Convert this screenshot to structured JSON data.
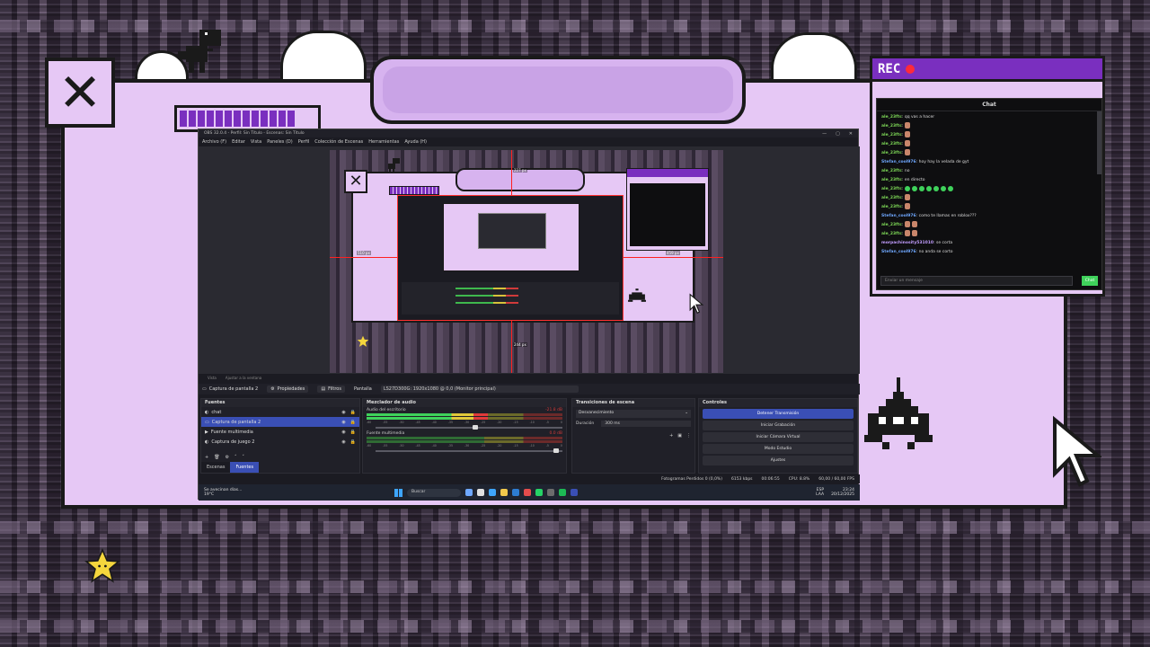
{
  "frame": {
    "close_glyph": "✕",
    "progress": 0.85
  },
  "rec": {
    "label": "REC",
    "chat_title": "Chat",
    "input_placeholder": "Enviar un mensaje",
    "send_label": "Chat",
    "messages": [
      {
        "user": "ale_23ftc",
        "text": ": qq vas a hacer",
        "emotes": 0,
        "color": "green"
      },
      {
        "user": "ale_23ftc",
        "text": ":",
        "emotes": 1,
        "color": "green"
      },
      {
        "user": "ale_23ftc",
        "text": ":",
        "emotes": 1,
        "color": "green"
      },
      {
        "user": "ale_23ftc",
        "text": ":",
        "emotes": 1,
        "color": "green"
      },
      {
        "user": "ale_23ftc",
        "text": ":",
        "emotes": 1,
        "color": "green"
      },
      {
        "user": "Stefan_cool976",
        "text": ": hoy hay la velada de gyt",
        "emotes": 0,
        "color": "blue"
      },
      {
        "user": "ale_23ftc",
        "text": ": no",
        "emotes": 0,
        "color": "green"
      },
      {
        "user": "ale_23ftc",
        "text": ": en directo",
        "emotes": 0,
        "color": "green"
      },
      {
        "user": "ale_23ftc",
        "text": ":",
        "emotes": 7,
        "color": "green"
      },
      {
        "user": "ale_23ftc",
        "text": ":",
        "emotes": 1,
        "color": "green"
      },
      {
        "user": "ale_23ftc",
        "text": ":",
        "emotes": 1,
        "color": "green"
      },
      {
        "user": "Stefan_cool976",
        "text": ": como te llamas en roblox???",
        "emotes": 0,
        "color": "blue"
      },
      {
        "user": "ale_23ftc",
        "text": ":",
        "emotes": 2,
        "color": "green"
      },
      {
        "user": "ale_23ftc",
        "text": ":",
        "emotes": 2,
        "color": "green"
      },
      {
        "user": "morpachinosity531010",
        "text": ": se corta",
        "emotes": 0,
        "color": "purple"
      },
      {
        "user": "Stefan_cool976",
        "text": ": no anda se corto",
        "emotes": 0,
        "color": "blue"
      }
    ]
  },
  "obs": {
    "title": "OBS 32.0.4 - Perfil: Sin Título - Escenas: Sin Título",
    "window_buttons": [
      "—",
      "▢",
      "✕"
    ],
    "menus": [
      "Archivo (F)",
      "Editar",
      "Vista",
      "Paneles (D)",
      "Perfil",
      "Colección de Escenas",
      "Herramientas",
      "Ayuda (H)"
    ],
    "guides": {
      "top": "227 px",
      "left": "510 px",
      "right": "459 px",
      "bottom": "244 px"
    },
    "tools": [
      "Vista",
      "Ajustar a la ventana"
    ],
    "sourcebar": {
      "source": "Captura de pantalla 2",
      "props": "Propiedades",
      "filters": "Filtros",
      "screen_label": "Pantalla",
      "screen_value": "LS27D300G: 1920x1080 @ 0,0 (Monitor principal)"
    },
    "sources": {
      "title": "Fuentes",
      "items": [
        {
          "icon": "chat-source-icon",
          "name": "chat",
          "selected": false
        },
        {
          "icon": "display-capture-icon",
          "name": "Captura de pantalla 2",
          "selected": true
        },
        {
          "icon": "media-source-icon",
          "name": "Fuente multimedia",
          "selected": false
        },
        {
          "icon": "game-capture-icon",
          "name": "Captura de juego 2",
          "selected": false
        }
      ],
      "tabs": [
        "Escenas",
        "Fuentes"
      ]
    },
    "mixer": {
      "title": "Mezclador de audio",
      "tracks": [
        {
          "name": "Audio del escritorio",
          "db": "-21.8 dB",
          "level": 0.62,
          "volume": 0.55
        },
        {
          "name": "Fuente multimedia",
          "db": "0.0 dB",
          "level": 0.0,
          "volume": 0.98
        }
      ],
      "scale": [
        "-60",
        "-55",
        "-50",
        "-45",
        "-40",
        "-35",
        "-30",
        "-25",
        "-20",
        "-15",
        "-10",
        "-5",
        "0"
      ]
    },
    "transitions": {
      "title": "Transiciones de escena",
      "selected": "Desvanecimiento",
      "duration_label": "Duración",
      "duration_value": "300 ms"
    },
    "controls": {
      "title": "Controles",
      "buttons": [
        "Detener Transmisión",
        "Iniciar Grabación",
        "Iniciar Cámara Virtual",
        "Modo Estudio",
        "Ajustes"
      ]
    },
    "status": {
      "dropped": "Fotogramas Perdidos 0 (0,0%)",
      "bitrate": "6153 kbps",
      "time": "00:06:55",
      "cpu": "CPU: 8.8%",
      "fps": "60,00 / 60,00 FPS"
    }
  },
  "taskbar": {
    "weather_line1": "Se avecinan días...",
    "weather_line2": "19°C",
    "search": "Buscar",
    "lang1": "ESP",
    "lang2": "LAA",
    "clock_time": "23:24",
    "clock_date": "20/12/2025"
  },
  "colors": {
    "lilac": "#e6c8f5",
    "purple": "#7a2fbf",
    "obs_blue": "#3a4fb5"
  }
}
